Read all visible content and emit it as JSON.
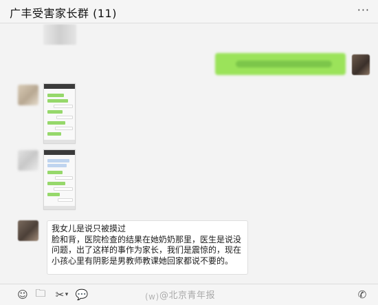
{
  "header": {
    "title": "广丰受害家长群 (11)",
    "more_label": "···"
  },
  "messages": {
    "text_lines": [
      "我女儿是说只被摸过",
      "脸和背，医院检查的结果在她奶奶那里，医生是说没",
      "问题，出了这样的事作为家长，我们是震惊的，现在",
      "小孩心里有阴影是男教师教课她回家都说不要的。"
    ]
  },
  "toolbar": {
    "emoji_icon": "☺",
    "folder_icon": "🗀",
    "scissors_icon": "✂",
    "chevron_icon": "▾",
    "chat_icon": "💬",
    "phone_icon": "✆"
  },
  "watermark": {
    "logo_icon": "(w)",
    "text": "@北京青年报"
  },
  "colors": {
    "outgoing_bubble": "#9be35a",
    "incoming_bubble": "#ffffff",
    "background": "#f3f3f3"
  }
}
